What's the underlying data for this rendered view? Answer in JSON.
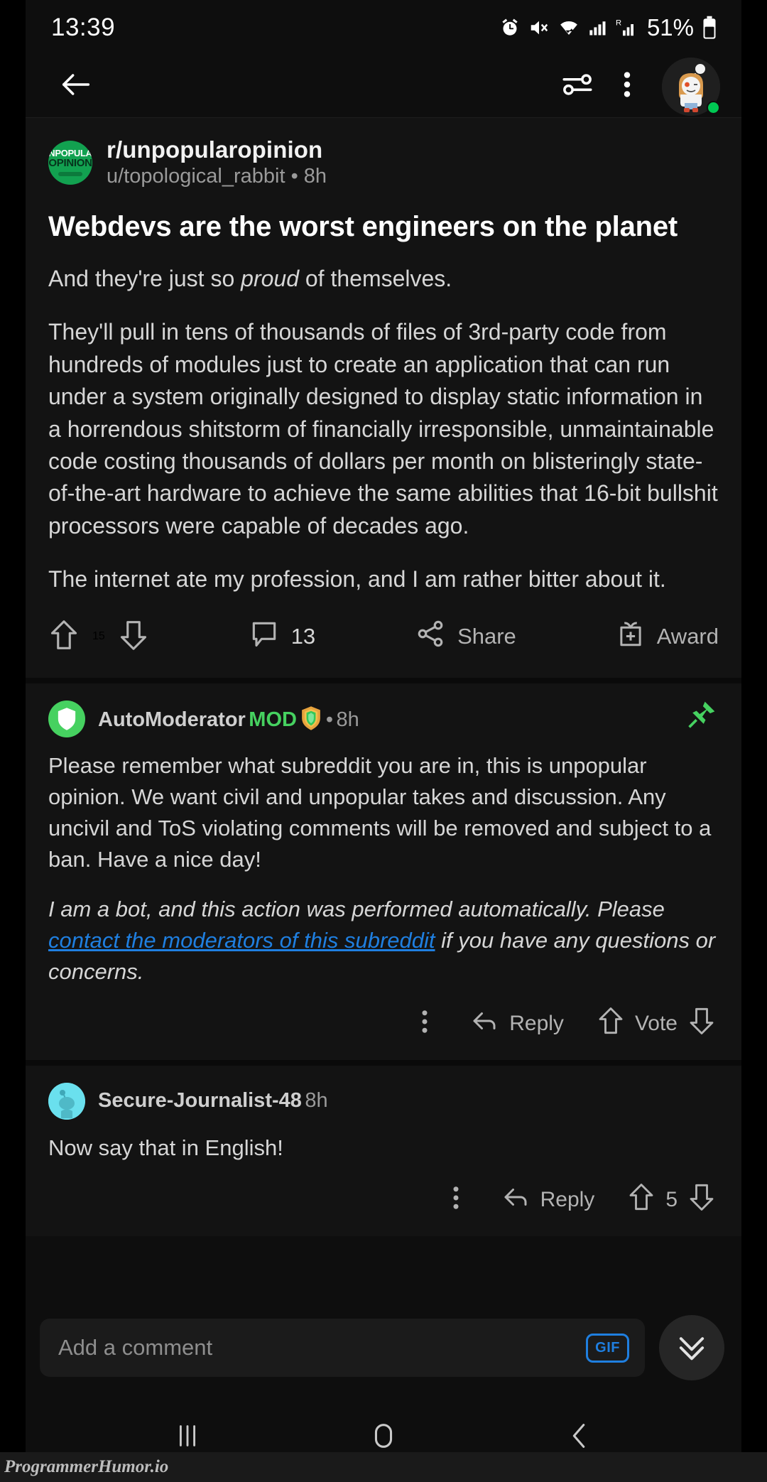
{
  "status_bar": {
    "time": "13:39",
    "battery_percent": "51%",
    "icons": [
      "alarm-icon",
      "mute-icon",
      "wifi-icon",
      "signal-icon",
      "roaming-signal-icon",
      "battery-icon"
    ]
  },
  "toolbar": {
    "back_icon": "back-arrow-icon",
    "sort_icon": "sort-sliders-icon",
    "overflow_icon": "more-vertical-icon",
    "avatar_icon": "user-avatar-icon",
    "online_status": "online"
  },
  "post": {
    "subreddit": "r/unpopularopinion",
    "subreddit_avatar_line1": "UNPOPULAR",
    "subreddit_avatar_line2": "OPINION",
    "author": "u/topological_rabbit",
    "separator": "•",
    "time": "8h",
    "title": "Webdevs are the worst engineers on the planet",
    "body": [
      "And they're just so proud of themselves.",
      "They'll pull in tens of thousands of files of 3rd-party code from hundreds of modules just to create an application that can run under a system originally designed to display static information in a horrendous shitstorm of financially irresponsible, unmaintainable code costing thousands of dollars per month on blisteringly state-of-the-art hardware to achieve the same abilities that 16-bit bullshit processors were capable of decades ago.",
      "The internet ate my profession, and I am rather bitter about it."
    ],
    "body_italic_word": "proud",
    "actions": {
      "upvote_icon": "upvote-arrow-icon",
      "score": "15",
      "downvote_icon": "downvote-arrow-icon",
      "comment_icon": "comment-bubble-icon",
      "comment_count": "13",
      "share_icon": "share-icon",
      "share_label": "Share",
      "award_icon": "award-gift-icon",
      "award_label": "Award"
    }
  },
  "comments": [
    {
      "author": "AutoModerator",
      "mod_badge": "MOD",
      "badge_icon": "mod-shield-badge-icon",
      "separator": "•",
      "time": "8h",
      "pinned_icon": "pin-icon",
      "avatar_icon": "moderator-shield-avatar",
      "body_parts": [
        {
          "text": "Please remember what subreddit you are in, this is unpopular opinion. We want civil and unpopular takes and discussion. Any uncivil and ToS violating comments will be removed and subject to a ban. Have a nice day!",
          "style": "normal"
        }
      ],
      "footer_pre": "I am a bot, and this action was performed automatically. Please ",
      "footer_link": "contact the moderators of this subreddit",
      "footer_post": " if you have any questions or concerns.",
      "actions": {
        "overflow_icon": "more-vertical-icon",
        "reply_icon": "reply-arrow-icon",
        "reply_label": "Reply",
        "upvote_icon": "upvote-arrow-icon",
        "vote_label": "Vote",
        "downvote_icon": "downvote-arrow-icon"
      }
    },
    {
      "author": "Secure-Journalist-48",
      "time": "8h",
      "avatar_icon": "snoo-avatar-icon",
      "body": "Now say that in English!",
      "actions": {
        "overflow_icon": "more-vertical-icon",
        "reply_icon": "reply-arrow-icon",
        "reply_label": "Reply",
        "upvote_icon": "upvote-arrow-icon",
        "score": "5",
        "downvote_icon": "downvote-arrow-icon"
      }
    }
  ],
  "comment_bar": {
    "placeholder": "Add a comment",
    "gif_label": "GIF",
    "scroll_down_icon": "double-chevron-down-icon"
  },
  "nav_bar": {
    "recents_icon": "recents-icon",
    "home_icon": "home-icon",
    "back_icon": "back-chevron-icon"
  },
  "watermark": {
    "text": "ProgrammerHumor.io"
  },
  "colors": {
    "background": "#0e0e0e",
    "surface": "#131313",
    "accent_green": "#46d160",
    "link_blue": "#1f7fe0",
    "subreddit_green": "#12a150",
    "snoo_cyan": "#6ae0ee"
  }
}
